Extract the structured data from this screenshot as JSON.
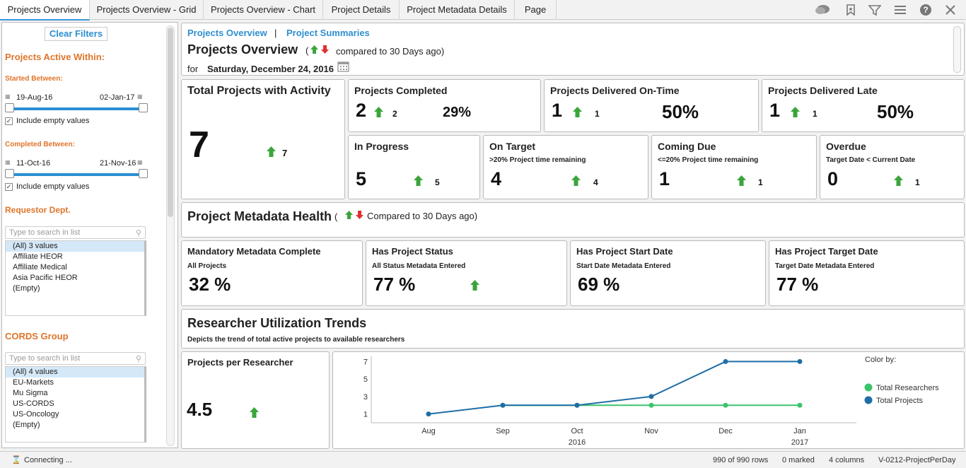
{
  "tabs": [
    "Projects Overview",
    "Projects Overview - Grid",
    "Projects Overview - Chart",
    "Project Details",
    "Project Metadata Details",
    "Page"
  ],
  "toolbar": {
    "icons": [
      "comment-icon",
      "bookmark-icon",
      "filter-icon",
      "menu-icon",
      "help-icon",
      "close-icon"
    ]
  },
  "filters": {
    "clear_label": "Clear Filters",
    "active_heading": "Projects Active Within:",
    "started": {
      "label": "Started Between:",
      "from": "19-Aug-16",
      "to": "02-Jan-17",
      "include": "Include empty values"
    },
    "completed": {
      "label": "Completed Between:",
      "from": "11-Oct-16",
      "to": "21-Nov-16",
      "include": "Include empty values"
    },
    "dept": {
      "heading": "Requestor Dept.",
      "placeholder": "Type to search in list",
      "items": [
        "(All) 3 values",
        "Affiliate HEOR",
        "Affiliate Medical",
        "Asia Pacific HEOR",
        "(Empty)"
      ]
    },
    "cords": {
      "heading": "CORDS Group",
      "placeholder": "Type to search in list",
      "items": [
        "(All) 4 values",
        "EU-Markets",
        "Mu Sigma",
        "US-CORDS",
        "US-Oncology",
        "(Empty)"
      ]
    }
  },
  "header": {
    "link1": "Projects Overview",
    "sep": "|",
    "link2": "Project Summaries",
    "title": "Projects Overview",
    "paren_open": "(",
    "compared": "compared to 30 Days ago)",
    "for": "for",
    "date": "Saturday, December 24, 2016"
  },
  "kpi": {
    "total": {
      "title": "Total Projects with Activity",
      "value": "7",
      "delta": "7"
    },
    "completed": {
      "title": "Projects Completed",
      "value": "2",
      "delta": "2",
      "pct": "29%"
    },
    "ontime": {
      "title": "Projects Delivered On-Time",
      "value": "1",
      "delta": "1",
      "pct": "50%"
    },
    "late": {
      "title": "Projects Delivered Late",
      "value": "1",
      "delta": "1",
      "pct": "50%"
    },
    "progress": {
      "title": "In Progress",
      "value": "5",
      "delta": "5"
    },
    "ontarget": {
      "title": "On Target",
      "sub": ">20% Project time remaining",
      "value": "4",
      "delta": "4"
    },
    "comingdue": {
      "title": "Coming Due",
      "sub": "<=20% Project time remaining",
      "value": "1",
      "delta": "1"
    },
    "overdue": {
      "title": "Overdue",
      "sub": "Target Date < Current Date",
      "value": "0",
      "delta": "1"
    }
  },
  "health": {
    "title": "Project Metadata Health",
    "paren_open": "(",
    "compared": "Compared to 30 Days ago)",
    "cards": [
      {
        "title": "Mandatory Metadata Complete",
        "sub": "All Projects",
        "value": "32 %"
      },
      {
        "title": "Has Project Status",
        "sub": "All Status Metadata Entered",
        "value": "77 %"
      },
      {
        "title": "Has Project Start Date",
        "sub": "Start Date Metadata Entered",
        "value": "69 %"
      },
      {
        "title": "Has Project Target Date",
        "sub": "Target Date Metadata Entered",
        "value": "77 %"
      }
    ]
  },
  "trends": {
    "title": "Researcher Utilization Trends",
    "sub": "Depicts the trend of total active projects to available researchers",
    "ppr": {
      "title": "Projects per Researcher",
      "value": "4.5"
    }
  },
  "chart_data": {
    "type": "line",
    "x": [
      "Aug",
      "Sep",
      "Oct",
      "Nov",
      "Dec",
      "Jan"
    ],
    "year_labels": [
      {
        "label": "2016",
        "at": "Oct"
      },
      {
        "label": "2017",
        "at": "Jan"
      }
    ],
    "yticks": [
      1,
      3,
      5,
      7
    ],
    "ylim": [
      0,
      7.6
    ],
    "legend_title": "Color by:",
    "legend_position": "right",
    "series": [
      {
        "name": "Total Researchers",
        "color": "#3cc46b",
        "values": [
          null,
          2,
          2,
          2,
          2,
          2
        ]
      },
      {
        "name": "Total Projects",
        "color": "#1f6ea6",
        "values": [
          1,
          2,
          2,
          3,
          7,
          7
        ]
      }
    ]
  },
  "status": {
    "connecting": "Connecting ...",
    "rows": "990 of 990 rows",
    "marked": "0 marked",
    "columns": "4 columns",
    "source": "V-0212-ProjectPerDay"
  }
}
